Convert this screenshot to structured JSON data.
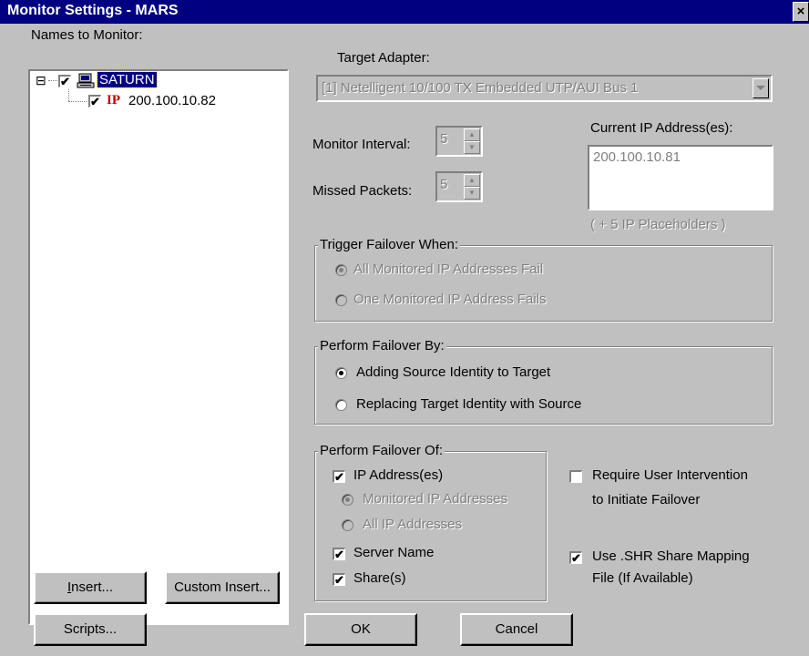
{
  "window": {
    "title": "Monitor Settings - MARS",
    "close_glyph": "×"
  },
  "names": {
    "label": "Names to Monitor:",
    "tree": {
      "root": {
        "label": "SATURN",
        "expander": "⊟",
        "checked": "✔"
      },
      "child": {
        "label": "200.100.10.82",
        "badge": "IP",
        "checked": "✔"
      }
    }
  },
  "adapter": {
    "label": "Target Adapter:",
    "value": "[1] Netelligent 10/100 TX Embedded UTP/AUI Bus 1"
  },
  "monitor_interval": {
    "label": "Monitor Interval:",
    "value": "5"
  },
  "missed_packets": {
    "label": "Missed Packets:",
    "value": "5"
  },
  "current_ip": {
    "label": "Current IP Address(es):",
    "values": [
      "200.100.10.81"
    ],
    "placeholders_note": "( + 5 IP Placeholders )"
  },
  "trigger": {
    "legend": "Trigger Failover When:",
    "options": [
      "All Monitored IP Addresses Fail",
      "One Monitored IP Address Fails"
    ],
    "selected_index": 0
  },
  "perform_by": {
    "legend": "Perform Failover By:",
    "options": [
      "Adding Source Identity to Target",
      "Replacing Target Identity with Source"
    ],
    "selected_index": 0
  },
  "perform_of": {
    "legend": "Perform Failover Of:",
    "ip_addresses": "IP Address(es)",
    "monitored_ip": "Monitored IP Addresses",
    "all_ip": "All IP Addresses",
    "server_name": "Server Name",
    "shares": "Share(s)"
  },
  "require_intervention": {
    "line1": "Require User Intervention",
    "line2": "to Initiate Failover",
    "checked": false
  },
  "use_shr": {
    "line1": "Use .SHR Share Mapping",
    "line2": "File (If Available)",
    "checked": true
  },
  "buttons": {
    "insert_pre": "I",
    "insert_post": "nsert...",
    "custom_insert": "Custom Insert...",
    "scripts": "Scripts...",
    "ok": "OK",
    "cancel": "Cancel"
  }
}
